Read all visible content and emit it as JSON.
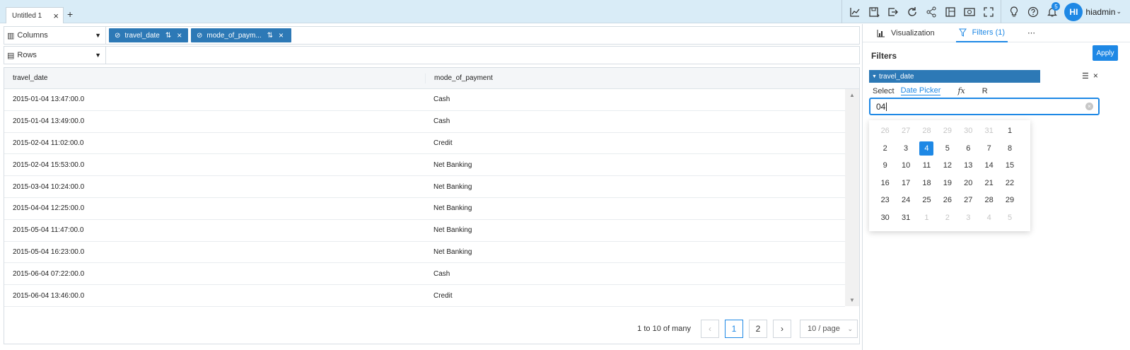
{
  "tabs": [
    {
      "label": "Untitled 1"
    }
  ],
  "user": {
    "initials": "HI",
    "name": "hiadmin"
  },
  "notifications": {
    "count": "5"
  },
  "columns_shelf": {
    "label": "Columns",
    "pills": [
      {
        "label": "travel_date"
      },
      {
        "label": "mode_of_paym..."
      }
    ]
  },
  "rows_shelf": {
    "label": "Rows"
  },
  "table": {
    "headers": [
      "travel_date",
      "mode_of_payment"
    ],
    "rows": [
      [
        "2015-01-04 13:47:00.0",
        "Cash"
      ],
      [
        "2015-01-04 13:49:00.0",
        "Cash"
      ],
      [
        "2015-02-04 11:02:00.0",
        "Credit"
      ],
      [
        "2015-02-04 15:53:00.0",
        "Net Banking"
      ],
      [
        "2015-03-04 10:24:00.0",
        "Net Banking"
      ],
      [
        "2015-04-04 12:25:00.0",
        "Net Banking"
      ],
      [
        "2015-05-04 11:47:00.0",
        "Net Banking"
      ],
      [
        "2015-05-04 16:23:00.0",
        "Net Banking"
      ],
      [
        "2015-06-04 07:22:00.0",
        "Cash"
      ],
      [
        "2015-06-04 13:46:00.0",
        "Credit"
      ]
    ]
  },
  "pager": {
    "summary": "1 to 10 of many",
    "pages": [
      "1",
      "2"
    ],
    "page_size": "10 / page"
  },
  "right_panel": {
    "tabs": [
      "Visualization",
      "Filters (1)"
    ],
    "filters_title": "Filters",
    "apply_label": "Apply",
    "filter": {
      "field": "travel_date"
    },
    "modes": [
      "Select",
      "Date Picker",
      "fx",
      "R"
    ],
    "input_value": "04"
  },
  "calendar": {
    "selected_day": "4",
    "weeks": [
      [
        [
          "26",
          true
        ],
        [
          "27",
          true
        ],
        [
          "28",
          true
        ],
        [
          "29",
          true
        ],
        [
          "30",
          true
        ],
        [
          "31",
          true
        ],
        [
          "1",
          false
        ]
      ],
      [
        [
          "2",
          false
        ],
        [
          "3",
          false
        ],
        [
          "4",
          false
        ],
        [
          "5",
          false
        ],
        [
          "6",
          false
        ],
        [
          "7",
          false
        ],
        [
          "8",
          false
        ]
      ],
      [
        [
          "9",
          false
        ],
        [
          "10",
          false
        ],
        [
          "11",
          false
        ],
        [
          "12",
          false
        ],
        [
          "13",
          false
        ],
        [
          "14",
          false
        ],
        [
          "15",
          false
        ]
      ],
      [
        [
          "16",
          false
        ],
        [
          "17",
          false
        ],
        [
          "18",
          false
        ],
        [
          "19",
          false
        ],
        [
          "20",
          false
        ],
        [
          "21",
          false
        ],
        [
          "22",
          false
        ]
      ],
      [
        [
          "23",
          false
        ],
        [
          "24",
          false
        ],
        [
          "25",
          false
        ],
        [
          "26",
          false
        ],
        [
          "27",
          false
        ],
        [
          "28",
          false
        ],
        [
          "29",
          false
        ]
      ],
      [
        [
          "30",
          false
        ],
        [
          "31",
          false
        ],
        [
          "1",
          true
        ],
        [
          "2",
          true
        ],
        [
          "3",
          true
        ],
        [
          "4",
          true
        ],
        [
          "5",
          true
        ]
      ]
    ]
  },
  "colors": {
    "accent": "#1e88e5",
    "pill": "#2d79b6",
    "topbar": "#d9ecf7"
  }
}
